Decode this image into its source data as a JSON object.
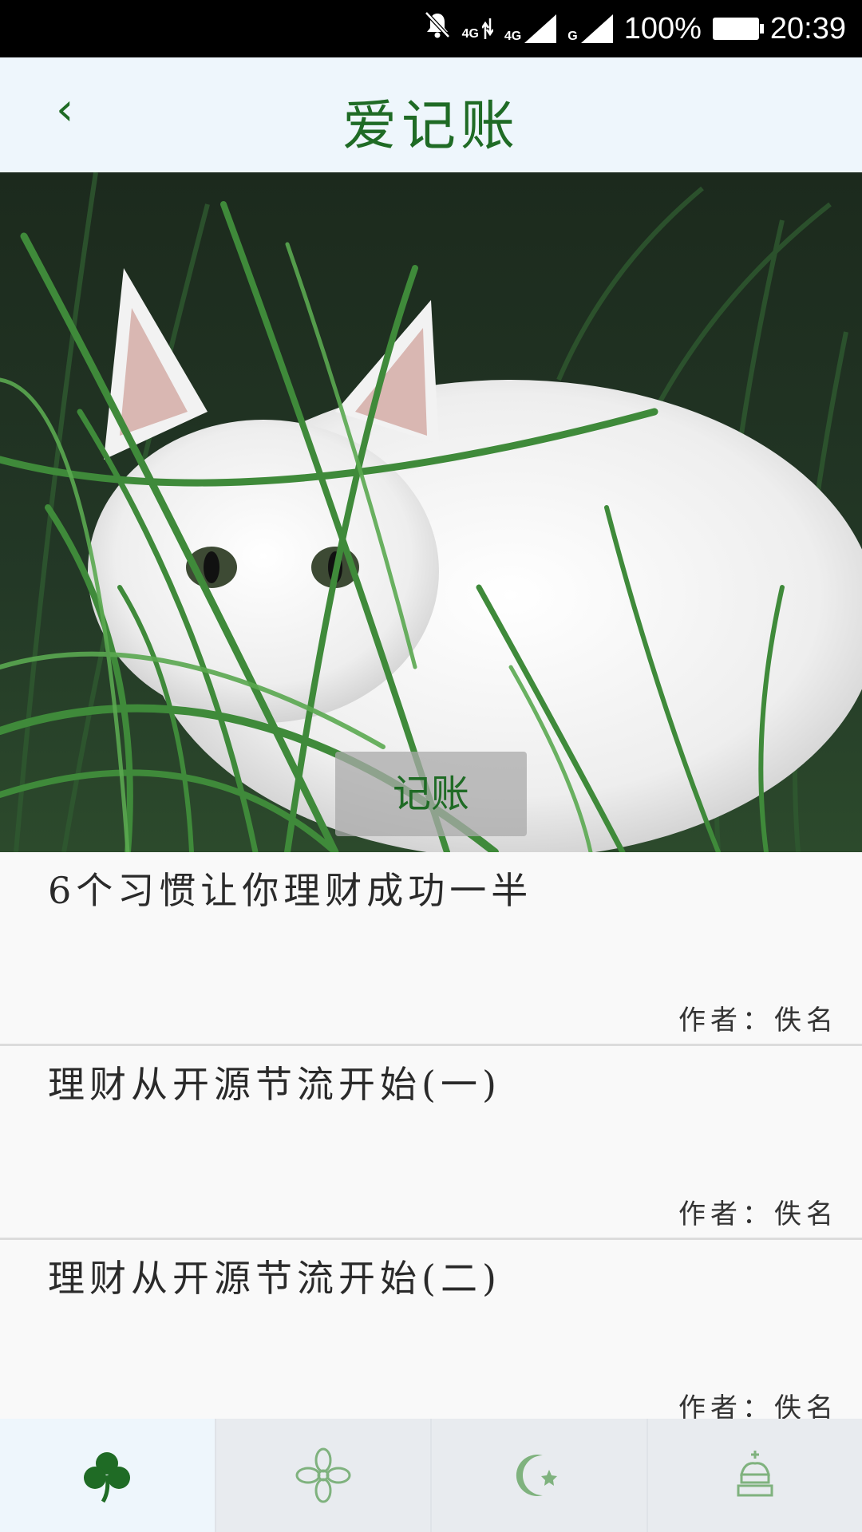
{
  "status": {
    "signal_1": "4G",
    "signal_2": "4G",
    "signal_3": "G",
    "battery": "100%",
    "time": "20:39"
  },
  "app": {
    "title": "爱记账",
    "back_glyph": "‹"
  },
  "hero": {
    "button_label": "记账"
  },
  "articles": [
    {
      "title": "6个习惯让你理财成功一半",
      "author": "作者：佚名"
    },
    {
      "title": "理财从开源节流开始(一)",
      "author": "作者：佚名"
    },
    {
      "title": "理财从开源节流开始(二)",
      "author": "作者：佚名"
    }
  ],
  "tabs": [
    {
      "icon": "clover-icon",
      "active": true
    },
    {
      "icon": "flower-icon",
      "active": false
    },
    {
      "icon": "crescent-star-icon",
      "active": false
    },
    {
      "icon": "crown-icon",
      "active": false
    }
  ],
  "colors": {
    "accent": "#1f6b25",
    "topbar": "#eef6fc",
    "tabbar": "#e8ebef"
  }
}
